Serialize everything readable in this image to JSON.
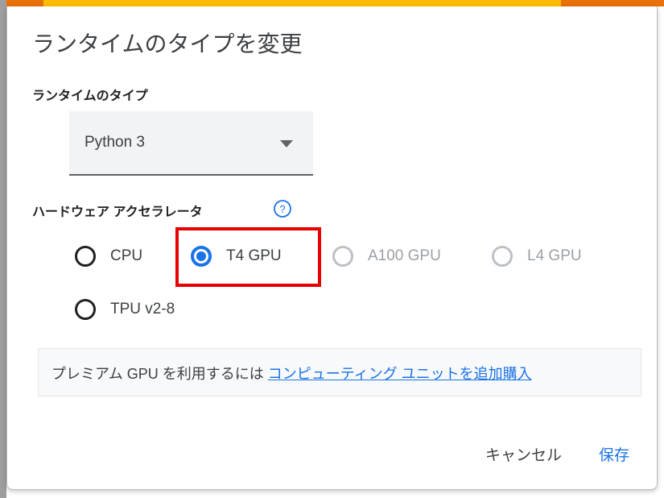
{
  "dialog": {
    "title": "ランタイムのタイプを変更",
    "runtime_type": {
      "label": "ランタイムのタイプ",
      "selected_value": "Python 3",
      "arrow_icon": "chevron-down-icon"
    },
    "accelerator": {
      "label": "ハードウェア アクセラレータ",
      "help_icon": "help-circle-icon",
      "options": [
        {
          "id": "cpu",
          "label": "CPU",
          "selected": false,
          "disabled": false
        },
        {
          "id": "t4",
          "label": "T4 GPU",
          "selected": true,
          "disabled": false
        },
        {
          "id": "a100",
          "label": "A100 GPU",
          "selected": false,
          "disabled": true
        },
        {
          "id": "l4",
          "label": "L4 GPU",
          "selected": false,
          "disabled": true
        },
        {
          "id": "tpu",
          "label": "TPU v2-8",
          "selected": false,
          "disabled": false
        }
      ]
    },
    "premium_notice": {
      "text": "プレミアム GPU を利用するには",
      "link_text": "コンピューティング ユニットを追加購入"
    },
    "actions": {
      "cancel_label": "キャンセル",
      "save_label": "保存"
    }
  },
  "annotation": {
    "highlight_target": "t4",
    "color": "#e60000"
  },
  "colors": {
    "accent_blue": "#1a73e8",
    "progress_light": "#fbbc04",
    "progress_dark": "#e8710a",
    "text_primary": "#3c4043",
    "text_disabled": "#9aa0a6"
  }
}
